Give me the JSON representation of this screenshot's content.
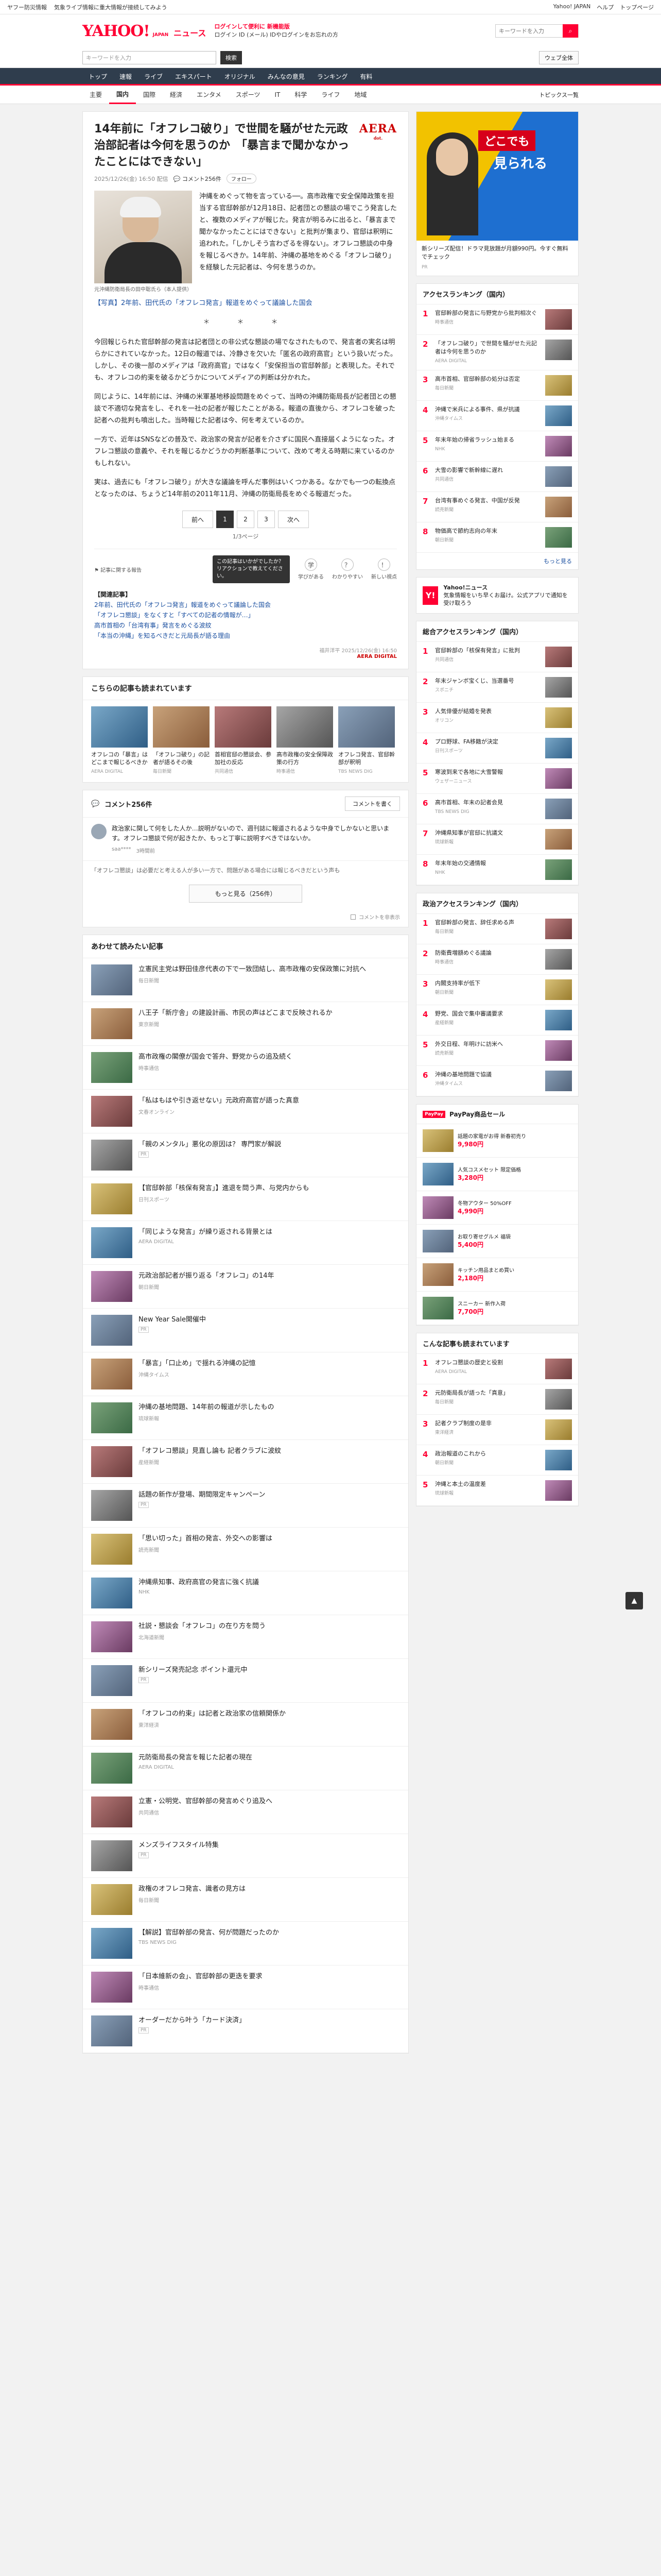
{
  "topbar": {
    "links": [
      "ヤフー防災情報",
      "気象ライブ情報に重大情報が接続してみよう"
    ],
    "right": [
      "Yahoo! JAPAN",
      "ヘルプ",
      "トップページ"
    ]
  },
  "header": {
    "logo": "YAHOO!",
    "logo_sub": "JAPAN",
    "service": "ニュース",
    "info_line1": "ログインして便利に 新機能版",
    "info_line2": "ログイン ID (メール) IDやログインをお忘れの方",
    "search_placeholder": "キーワードを入力",
    "search_button": "検索"
  },
  "searchrow": {
    "placeholder": "キーワードを入力",
    "go": "検索",
    "web": "ウェブ全体"
  },
  "nav": [
    "トップ",
    "速報",
    "ライブ",
    "エキスパート",
    "オリジナル",
    "みんなの意見",
    "ランキング",
    "有料"
  ],
  "subnav": {
    "items": [
      "主要",
      "国内",
      "国際",
      "経済",
      "エンタメ",
      "スポーツ",
      "IT",
      "科学",
      "ライフ",
      "地域"
    ],
    "active": 1,
    "topics": "トピックス一覧"
  },
  "article": {
    "title": "14年前に「オフレコ破り」で世間を騒がせた元政治部記者は今何を思うのか　「暴言まで聞かなかったことにはできない」",
    "brand": "AERA",
    "brand_sub": "dot.",
    "date": "2025/12/26(金) 16:50 配信",
    "comments_label": "コメント256件",
    "follow": "フォロー",
    "photo_caption": "元沖縄防衛局長の田中聡氏ら（本人提供）",
    "lead_paragraph": "沖縄をめぐって物を言っている──。高市政権で安全保障政策を担当する官邸幹部が12月18日、記者団との懇談の場でこう発言したと、複数のメディアが報じた。発言が明るみに出ると、「暴言まで聞かなかったことにはできない」と批判が集まり、官邸は釈明に追われた。「しかしそう言わざるを得ない」。オフレコ懇談の中身を報じるべきか。14年前、沖縄の基地をめぐる「オフレコ破り」を経験した元記者は、今何を思うのか。",
    "related_link": "【写真】2年前、田代氏の「オフレコ発言」報道をめぐって議論した国会",
    "paragraphs": [
      "今回報じられた官邸幹部の発言は記者団との非公式な懇談の場でなされたもので、発言者の実名は明らかにされていなかった。12日の報道では、冷静さを欠いた「匿名の政府高官」という扱いだった。しかし、その後一部のメディアは「政府高官」ではなく「安保担当の官邸幹部」と表現した。それでも、オフレコの約束を破るかどうかについてメディアの判断は分かれた。",
      "同じように、14年前には、沖縄の米軍基地移設問題をめぐって、当時の沖縄防衛局長が記者団との懇談で不適切な発言をし、それを一社の記者が報じたことがある。報道の直後から、オフレコを破った記者への批判も噴出した。当時報じた記者は今、何を考えているのか。",
      "一方で、近年はSNSなどの普及で、政治家の発言が記者を介さずに国民へ直接届くようになった。オフレコ懇談の意義や、それを報じるかどうかの判断基準について、改めて考える時期に来ているのかもしれない。",
      "実は、過去にも「オフレコ破り」が大きな議論を呼んだ事例はいくつかある。なかでも一つの転換点となったのは、ちょうど14年前の2011年11月、沖縄の防衛局長をめぐる報道だった。"
    ],
    "stars": "＊　＊　＊",
    "pager": {
      "prev": "前へ",
      "pages": [
        "1",
        "2",
        "3"
      ],
      "current": 0,
      "next": "次へ",
      "note": "1/3ページ"
    },
    "reactions": [
      {
        "icon": "学",
        "label": "学びがある"
      },
      {
        "icon": "？",
        "label": "わかりやすい"
      },
      {
        "icon": "！",
        "label": "新しい視点"
      }
    ],
    "tooltip": "この記事はいかがでしたか？リアクションで教えてください。",
    "report": "記事に関する報告",
    "summary_head": "【関連記事】",
    "summary_links": [
      "2年前、田代氏の「オフレコ発言」報道をめぐって議論した国会",
      "「オフレコ懇談」をなくすと「すべての記者の情報が…」",
      "高市首相の「台湾有事」発言をめぐる波紋",
      "「本当の沖縄」を知るべきだと元局長が語る理由"
    ],
    "credit": "福井洋平 2025/12/26(金) 16:50",
    "credit_brand": "AERA DIGITAL"
  },
  "recommend": {
    "title": "こちらの記事も読まれています",
    "items": [
      {
        "text": "オフレコの「暴言」はどこまで報じるべきか",
        "src": "AERA DIGITAL"
      },
      {
        "text": "「オフレコ破り」の記者が語るその後",
        "src": "毎日新聞"
      },
      {
        "text": "首相官邸の懇談会、参加社の反応",
        "src": "共同通信"
      },
      {
        "text": "高市政権の安全保障政策の行方",
        "src": "時事通信"
      },
      {
        "text": "オフレコ発言、官邸幹部が釈明",
        "src": "TBS NEWS DIG"
      }
    ]
  },
  "comments": {
    "count_label": "コメント256件",
    "write": "コメントを書く",
    "item_text": "政治家に関して何をした人か…説明がないので、週刊誌に報道されるような中身でしかないと思います。オフレコ懇談で何が起きたか、もっと丁寧に説明すべきではないか。",
    "item_user": "saa****",
    "item_time": "3時間前",
    "note": "「オフレコ懇談」は必要だと考える人が多い一方で、問題がある場合には報じるべきだという声も",
    "more": "もっと見る（256件）",
    "hide": "コメントを非表示"
  },
  "feed": {
    "title": "あわせて読みたい記事",
    "items": [
      {
        "title": "立憲民主党は野田佳彦代表の下で一致団結し、高市政権の安保政策に対抗へ",
        "src": "毎日新聞",
        "ad": false
      },
      {
        "title": "八王子「新庁舎」の建設計画、市民の声はどこまで反映されるか",
        "src": "東京新聞",
        "ad": false
      },
      {
        "title": "高市政権の閣僚が国会で答弁、野党からの追及続く",
        "src": "時事通信",
        "ad": false
      },
      {
        "title": "「私はもはや引き返せない」元政府高官が語った真意",
        "src": "文春オンライン",
        "ad": false
      },
      {
        "title": "「親のメンタル」悪化の原因は？ 専門家が解説",
        "src": "PR",
        "ad": true
      },
      {
        "title": "【官邸幹部「核保有発言」】進退を問う声、与党内からも",
        "src": "日刊スポーツ",
        "ad": false
      },
      {
        "title": "「同じような発言」が繰り返される背景とは",
        "src": "AERA DIGITAL",
        "ad": false
      },
      {
        "title": "元政治部記者が振り返る「オフレコ」の14年",
        "src": "朝日新聞",
        "ad": false
      },
      {
        "title": "New Year Sale開催中",
        "src": "PR",
        "ad": true
      },
      {
        "title": "「暴言」「口止め」で揺れる沖縄の記憶",
        "src": "沖縄タイムス",
        "ad": false
      },
      {
        "title": "沖縄の基地問題、14年前の報道が示したもの",
        "src": "琉球新報",
        "ad": false
      },
      {
        "title": "「オフレコ懇談」見直し論も 記者クラブに波紋",
        "src": "産経新聞",
        "ad": false
      },
      {
        "title": "話題の新作が登場、期間限定キャンペーン",
        "src": "PR",
        "ad": true
      },
      {
        "title": "「思い切った」首相の発言、外交への影響は",
        "src": "読売新聞",
        "ad": false
      },
      {
        "title": "沖縄県知事、政府高官の発言に強く抗議",
        "src": "NHK",
        "ad": false
      },
      {
        "title": "社説・懇談会「オフレコ」の在り方を問う",
        "src": "北海道新聞",
        "ad": false
      },
      {
        "title": "新シリーズ発売記念 ポイント還元中",
        "src": "PR",
        "ad": true
      },
      {
        "title": "「オフレコの約束」は記者と政治家の信頼関係か",
        "src": "東洋経済",
        "ad": false
      },
      {
        "title": "元防衛局長の発言を報じた記者の現在",
        "src": "AERA DIGITAL",
        "ad": false
      },
      {
        "title": "立憲・公明党、官邸幹部の発言めぐり追及へ",
        "src": "共同通信",
        "ad": false
      },
      {
        "title": "メンズライフスタイル特集",
        "src": "PR",
        "ad": true
      },
      {
        "title": "政権のオフレコ発言、識者の見方は",
        "src": "毎日新聞",
        "ad": false
      },
      {
        "title": "【解説】官邸幹部の発言、何が問題だったのか",
        "src": "TBS NEWS DIG",
        "ad": false
      },
      {
        "title": "「日本維新の会」、官邸幹部の更迭を要求",
        "src": "時事通信",
        "ad": false
      },
      {
        "title": "オーダーだから叶う「カード決済」",
        "src": "PR",
        "ad": true
      }
    ]
  },
  "side": {
    "ad_title": "どこでも",
    "ad_sub": "見られる",
    "ad_caption": "新シリーズ配信！ドラマ見放題が月額990円。今すぐ無料でチェック",
    "ad_sponsor": "PR",
    "ranking_domestic": {
      "title": "アクセスランキング（国内）",
      "items": [
        {
          "text": "官邸幹部の発言に与野党から批判相次ぐ",
          "src": "時事通信"
        },
        {
          "text": "「オフレコ破り」で世間を騒がせた元記者は今何を思うのか",
          "src": "AERA DIGITAL"
        },
        {
          "text": "高市首相、官邸幹部の処分は否定",
          "src": "毎日新聞"
        },
        {
          "text": "沖縄で米兵による事件、県が抗議",
          "src": "沖縄タイムス"
        },
        {
          "text": "年末年始の帰省ラッシュ始まる",
          "src": "NHK"
        },
        {
          "text": "大雪の影響で新幹線に遅れ",
          "src": "共同通信"
        },
        {
          "text": "台湾有事めぐる発言、中国が反発",
          "src": "読売新聞"
        },
        {
          "text": "物価高で節約志向の年末",
          "src": "朝日新聞"
        }
      ],
      "more": "もっと見る"
    },
    "promo_title": "Yahoo!ニュース",
    "promo_text": "気象情報をいち早くお届け。公式アプリで通知を受け取ろう",
    "ranking_comment": {
      "title": "総合アクセスランキング（国内）",
      "items": [
        {
          "text": "官邸幹部の「核保有発言」に批判",
          "src": "共同通信"
        },
        {
          "text": "年末ジャンボ宝くじ、当選番号",
          "src": "スポニチ"
        },
        {
          "text": "人気俳優が結婚を発表",
          "src": "オリコン"
        },
        {
          "text": "プロ野球、FA移籍が決定",
          "src": "日刊スポーツ"
        },
        {
          "text": "寒波到来で各地に大雪警報",
          "src": "ウェザーニュース"
        },
        {
          "text": "高市首相、年末の記者会見",
          "src": "TBS NEWS DIG"
        },
        {
          "text": "沖縄県知事が官邸に抗議文",
          "src": "琉球新報"
        },
        {
          "text": "年末年始の交通情報",
          "src": "NHK"
        }
      ]
    },
    "ranking_topic": {
      "title": "政治アクセスランキング（国内）",
      "items": [
        {
          "text": "官邸幹部の発言、辞任求める声",
          "src": "毎日新聞"
        },
        {
          "text": "防衛費増額めぐる議論",
          "src": "時事通信"
        },
        {
          "text": "内閣支持率が低下",
          "src": "朝日新聞"
        },
        {
          "text": "野党、国会で集中審議要求",
          "src": "産経新聞"
        },
        {
          "text": "外交日程、年明けに訪米へ",
          "src": "読売新聞"
        },
        {
          "text": "沖縄の基地問題で協議",
          "src": "沖縄タイムス"
        }
      ]
    },
    "shop": {
      "badge": "PayPay",
      "title": "PayPay商品セール",
      "items": [
        {
          "text": "話題の家電がお得 新春初売り",
          "price": "9,980円"
        },
        {
          "text": "人気コスメセット 限定価格",
          "price": "3,280円"
        },
        {
          "text": "冬物アウター 50%OFF",
          "price": "4,990円"
        },
        {
          "text": "お取り寄せグルメ 福袋",
          "price": "5,400円"
        },
        {
          "text": "キッチン用品まとめ買い",
          "price": "2,180円"
        },
        {
          "text": "スニーカー 新作入荷",
          "price": "7,700円"
        }
      ]
    },
    "recommend": {
      "title": "こんな記事も読まれています",
      "items": [
        {
          "text": "オフレコ懇談の歴史と役割",
          "src": "AERA DIGITAL"
        },
        {
          "text": "元防衛局長が語った「真意」",
          "src": "毎日新聞"
        },
        {
          "text": "記者クラブ制度の是非",
          "src": "東洋経済"
        },
        {
          "text": "政治報道のこれから",
          "src": "朝日新聞"
        },
        {
          "text": "沖縄と本土の温度差",
          "src": "琉球新報"
        }
      ]
    }
  },
  "float_btn": "▲"
}
